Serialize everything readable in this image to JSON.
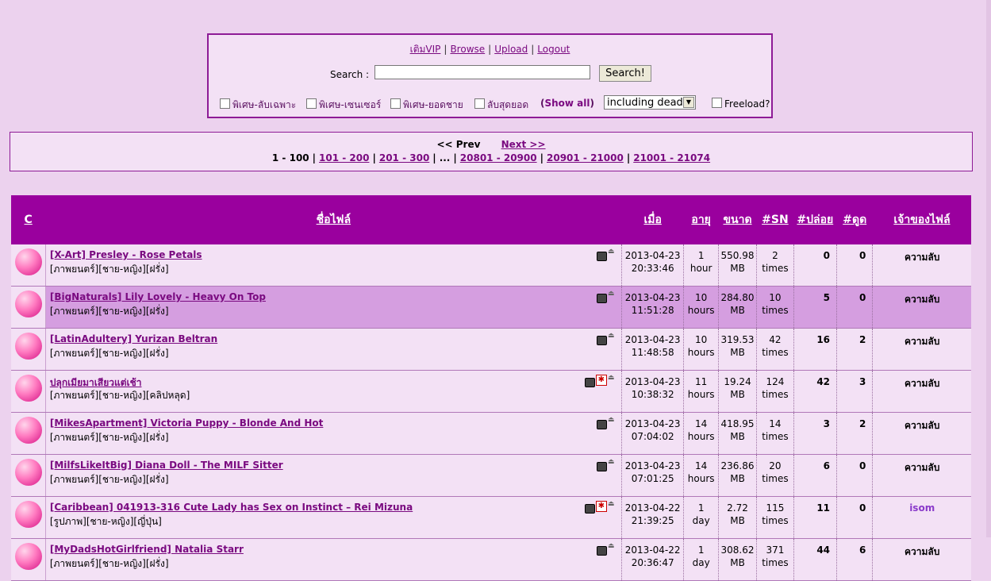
{
  "top": {
    "links": [
      "เติมVIP",
      "Browse",
      "Upload",
      "Logout"
    ],
    "search_label": "Search :",
    "search_value": "",
    "search_button": "Search!",
    "filters": [
      "พิเศษ-ลับเฉพาะ",
      "พิเศษ-เซนเซอร์",
      "พิเศษ-ยอดชาย",
      "ลับสุดยอด"
    ],
    "show_all_open": "(",
    "show_all": "Show all",
    "show_all_close": ")",
    "dead_select": "including dead",
    "freeload": "Freeload?"
  },
  "pager": {
    "prev": "<< Prev",
    "next": "Next >>",
    "current": "1 - 100",
    "pages": [
      "101 - 200",
      "201 - 300"
    ],
    "ellipsis": "...",
    "pages_end": [
      "20801 - 20900",
      "20901 - 21000",
      "21001 - 21074"
    ]
  },
  "table": {
    "headers": [
      "C",
      "ชื่อไฟล์",
      "เมื่อ",
      "อายุ",
      "ขนาด",
      "#SN",
      "#ปล่อย",
      "#ดูด",
      "เจ้าของไฟล์"
    ],
    "rows": [
      {
        "title": "[X-Art] Presley - Rose Petals",
        "tags": "[ภาพยนตร์][ชาย-หญิง][ฝรั่ง]",
        "date": "2013-04-23",
        "time": "20:33:46",
        "age_n": "1",
        "age_u": "hour",
        "size_n": "550.98",
        "size_u": "MB",
        "sn_n": "2",
        "sn_u": "times",
        "seed": "0",
        "leech": "0",
        "owner": "ความลับ",
        "new": false
      },
      {
        "title": "[BigNaturals] Lily Lovely - Heavy On Top",
        "tags": "[ภาพยนตร์][ชาย-หญิง][ฝรั่ง]",
        "date": "2013-04-23",
        "time": "11:51:28",
        "age_n": "10",
        "age_u": "hours",
        "size_n": "284.80",
        "size_u": "MB",
        "sn_n": "10",
        "sn_u": "times",
        "seed": "5",
        "leech": "0",
        "owner": "ความลับ",
        "new": false
      },
      {
        "title": "[LatinAdultery] Yurizan Beltran",
        "tags": "[ภาพยนตร์][ชาย-หญิง][ฝรั่ง]",
        "date": "2013-04-23",
        "time": "11:48:58",
        "age_n": "10",
        "age_u": "hours",
        "size_n": "319.53",
        "size_u": "MB",
        "sn_n": "42",
        "sn_u": "times",
        "seed": "16",
        "leech": "2",
        "owner": "ความลับ",
        "new": false
      },
      {
        "title": "ปลุกเมียมาเสียวแต่เช้า",
        "tags": "[ภาพยนตร์][ชาย-หญิง][คลิปหลุด]",
        "date": "2013-04-23",
        "time": "10:38:32",
        "age_n": "11",
        "age_u": "hours",
        "size_n": "19.24",
        "size_u": "MB",
        "sn_n": "124",
        "sn_u": "times",
        "seed": "42",
        "leech": "3",
        "owner": "ความลับ",
        "new": true
      },
      {
        "title": "[MikesApartment] Victoria Puppy - Blonde And Hot",
        "tags": "[ภาพยนตร์][ชาย-หญิง][ฝรั่ง]",
        "date": "2013-04-23",
        "time": "07:04:02",
        "age_n": "14",
        "age_u": "hours",
        "size_n": "418.95",
        "size_u": "MB",
        "sn_n": "14",
        "sn_u": "times",
        "seed": "3",
        "leech": "2",
        "owner": "ความลับ",
        "new": false
      },
      {
        "title": "[MilfsLikeItBig] Diana Doll - The MILF Sitter",
        "tags": "[ภาพยนตร์][ชาย-หญิง][ฝรั่ง]",
        "date": "2013-04-23",
        "time": "07:01:25",
        "age_n": "14",
        "age_u": "hours",
        "size_n": "236.86",
        "size_u": "MB",
        "sn_n": "20",
        "sn_u": "times",
        "seed": "6",
        "leech": "0",
        "owner": "ความลับ",
        "new": false
      },
      {
        "title": "[Caribbean] 041913-316 Cute Lady has Sex on Instinct – Rei Mizuna",
        "tags": "[รูปภาพ][ชาย-หญิง][ญี่ปุ่น]",
        "date": "2013-04-22",
        "time": "21:39:25",
        "age_n": "1",
        "age_u": "day",
        "size_n": "2.72",
        "size_u": "MB",
        "sn_n": "115",
        "sn_u": "times",
        "seed": "11",
        "leech": "0",
        "owner": "isom",
        "new": true
      },
      {
        "title": "[MyDadsHotGirlfriend] Natalia Starr",
        "tags": "[ภาพยนตร์][ชาย-หญิง][ฝรั่ง]",
        "date": "2013-04-22",
        "time": "20:36:47",
        "age_n": "1",
        "age_u": "day",
        "size_n": "308.62",
        "size_u": "MB",
        "sn_n": "371",
        "sn_u": "times",
        "seed": "44",
        "leech": "6",
        "owner": "ความลับ",
        "new": false
      }
    ]
  }
}
